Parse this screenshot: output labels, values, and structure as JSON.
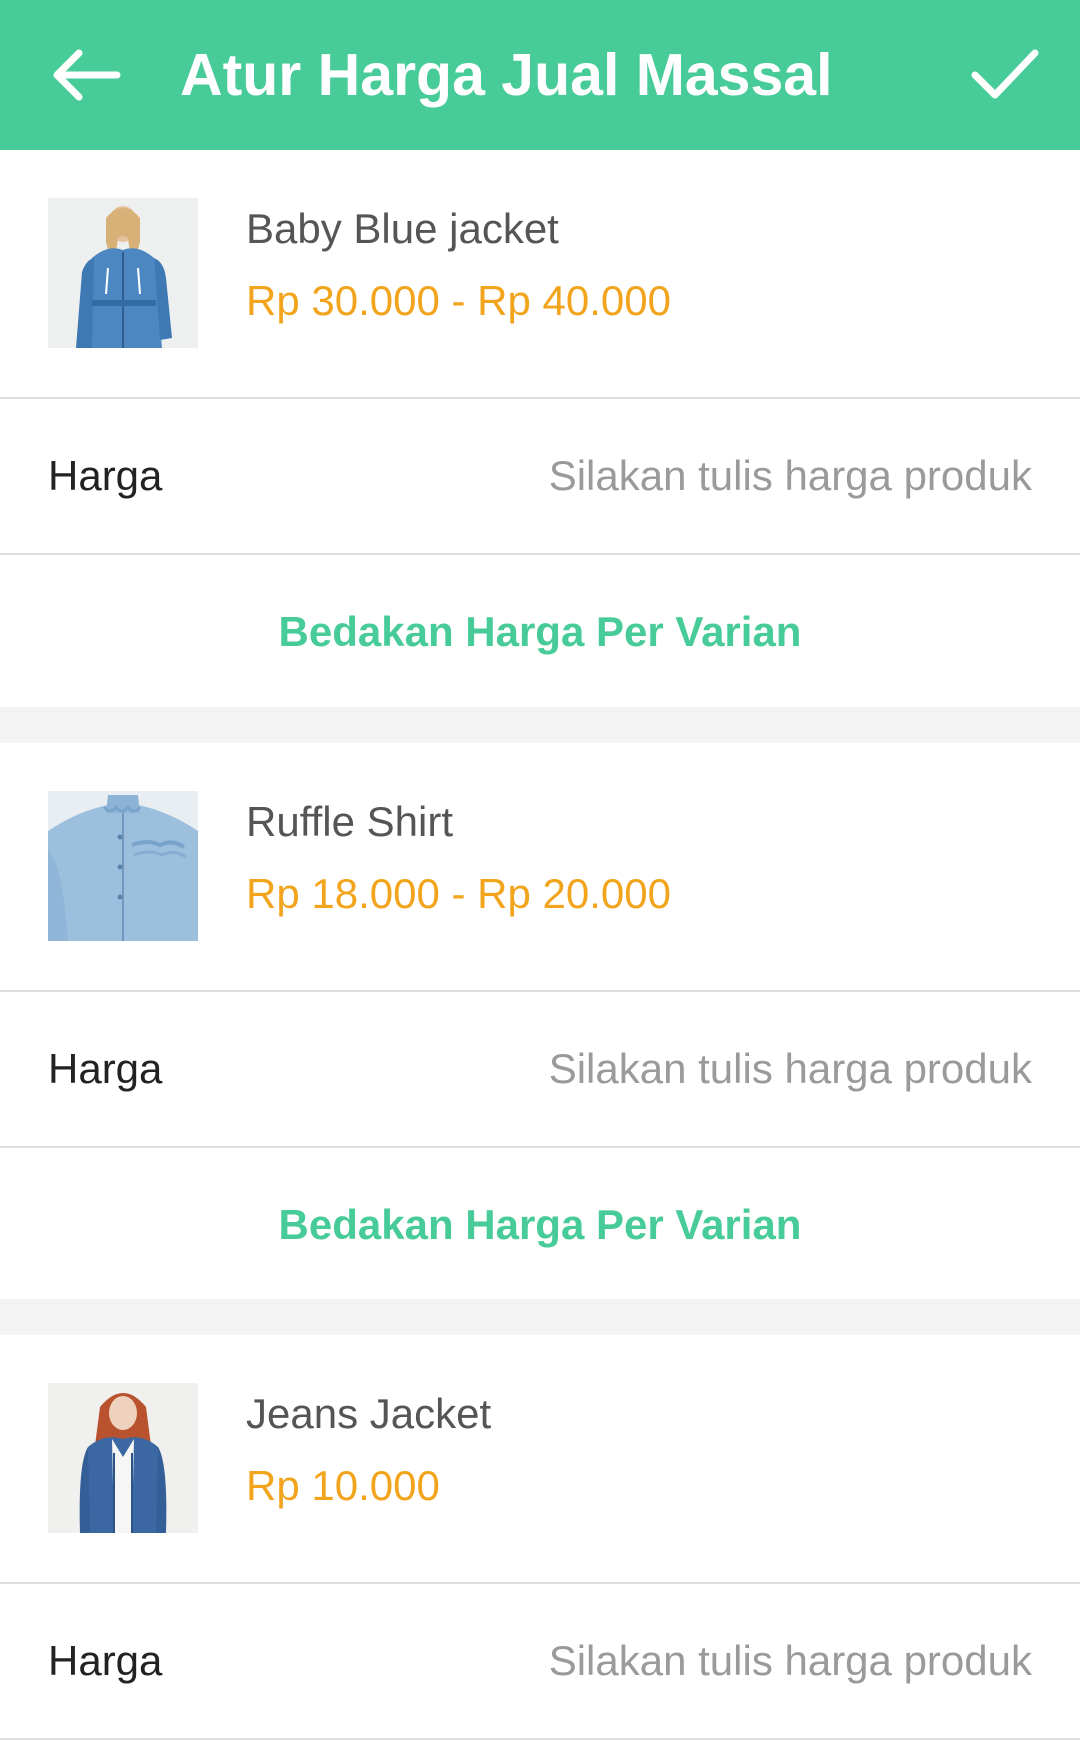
{
  "header": {
    "title": "Atur Harga Jual Massal",
    "back_icon": "arrow-left-icon",
    "confirm_icon": "checkmark-icon",
    "background_color": "#47CB98"
  },
  "products": [
    {
      "name": "Baby Blue jacket",
      "price": "Rp 30.000 - Rp 40.000",
      "harga_label": "Harga",
      "harga_placeholder": "Silakan tulis harga produk",
      "variant_button": "Bedakan Harga Per Varian"
    },
    {
      "name": "Ruffle Shirt",
      "price": "Rp 18.000 - Rp 20.000",
      "harga_label": "Harga",
      "harga_placeholder": "Silakan tulis harga produk",
      "variant_button": "Bedakan Harga Per Varian"
    },
    {
      "name": "Jeans Jacket",
      "price": "Rp 10.000",
      "harga_label": "Harga",
      "harga_placeholder": "Silakan tulis harga produk"
    }
  ],
  "colors": {
    "accent": "#47CB98",
    "price": "#F2A41C"
  }
}
